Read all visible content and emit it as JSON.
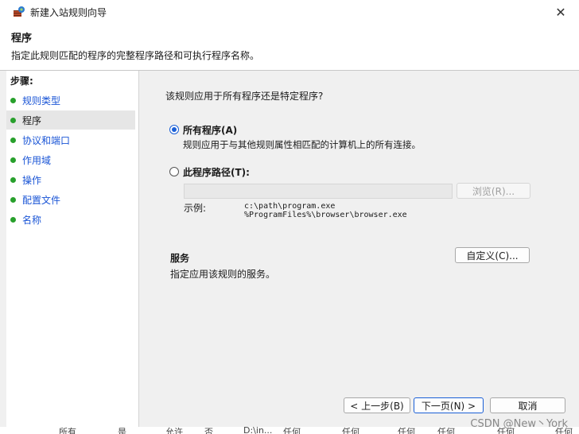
{
  "window": {
    "title": "新建入站规则向导",
    "icon": "firewall-wizard-icon",
    "close_glyph": "✕"
  },
  "header": {
    "title": "程序",
    "description": "指定此规则匹配的程序的完整程序路径和可执行程序名称。"
  },
  "sidebar": {
    "steps_label": "步骤:",
    "items": [
      {
        "label": "规则类型"
      },
      {
        "label": "程序"
      },
      {
        "label": "协议和端口"
      },
      {
        "label": "作用域"
      },
      {
        "label": "操作"
      },
      {
        "label": "配置文件"
      },
      {
        "label": "名称"
      }
    ]
  },
  "main": {
    "question": "该规则应用于所有程序还是特定程序?",
    "option_all": {
      "label": "所有程序(A)",
      "description": "规则应用于与其他规则属性相匹配的计算机上的所有连接。",
      "selected": true
    },
    "option_path": {
      "label": "此程序路径(T):",
      "selected": false,
      "value": "",
      "browse_label": "浏览(R)..."
    },
    "example_label": "示例:",
    "example_lines": [
      "c:\\path\\program.exe",
      "%ProgramFiles%\\browser\\browser.exe"
    ],
    "services": {
      "title": "服务",
      "description": "指定应用该规则的服务。",
      "customize_label": "自定义(C)..."
    }
  },
  "footer": {
    "back_label": "< 上一步(B)",
    "next_label": "下一页(N) >",
    "cancel_label": "取消"
  },
  "background_row": [
    "所有",
    "是",
    "允许",
    "否",
    "D:\\in...",
    "任何",
    "任何",
    "任何",
    "任何",
    "任何",
    "任何"
  ],
  "watermark": "CSDN @New丶York",
  "colors": {
    "accent": "#1a5fd6",
    "step_dot": "#28a02c",
    "link": "#1a55d6"
  }
}
